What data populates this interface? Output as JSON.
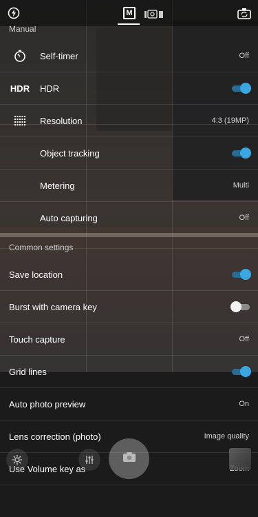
{
  "topbar": {
    "left_icon": "flash-icon",
    "modes": [
      "manual-mode-icon",
      "photo-mode-icon",
      "video-mode-icon"
    ],
    "right_icon": "switch-camera-icon"
  },
  "manual": {
    "title": "Manual",
    "rows": [
      {
        "icon": "timer-icon",
        "label": "Self-timer",
        "value": "Off"
      },
      {
        "icon_text": "HDR",
        "label": "HDR",
        "toggle": "on"
      },
      {
        "icon": "grid-dots-icon",
        "label": "Resolution",
        "value": "4:3 (19MP)"
      },
      {
        "label": "Object tracking",
        "toggle": "on"
      },
      {
        "label": "Metering",
        "value": "Multi"
      },
      {
        "label": "Auto capturing",
        "value": "Off"
      }
    ]
  },
  "common": {
    "title": "Common settings",
    "rows": [
      {
        "label": "Save location",
        "toggle": "on"
      },
      {
        "label": "Burst with camera key",
        "toggle": "off"
      },
      {
        "label": "Touch capture",
        "value": "Off"
      },
      {
        "label": "Grid lines",
        "toggle": "on"
      },
      {
        "label": "Auto photo preview",
        "value": "On"
      },
      {
        "label": "Lens correction (photo)",
        "value": "Image quality"
      },
      {
        "label": "Use Volume key as",
        "value": "Zoom"
      }
    ]
  },
  "bottom": {
    "settings_icon": "gear-icon",
    "filters_icon": "sliders-icon",
    "shutter_icon": "camera-icon",
    "gallery_icon": "gallery-thumbnail"
  },
  "colors": {
    "accent": "#3aa7e0"
  }
}
